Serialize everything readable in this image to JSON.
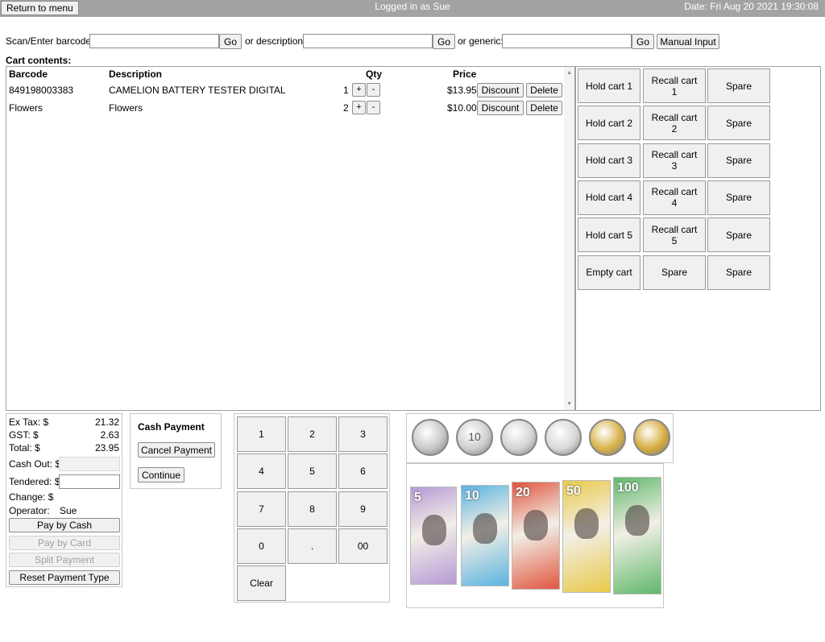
{
  "header": {
    "return_label": "Return to menu",
    "logged_in": "Logged in as Sue",
    "date": "Date: Fri Aug 20 2021 19:30:08"
  },
  "search": {
    "barcode_label": "Scan/Enter barcode:",
    "description_label": "or description:",
    "generic_label": "or generic:",
    "go_label": "Go",
    "manual_input_label": "Manual Input"
  },
  "cart": {
    "title": "Cart contents:",
    "columns": {
      "barcode": "Barcode",
      "description": "Description",
      "qty": "Qty",
      "price": "Price"
    },
    "discount_label": "Discount",
    "delete_label": "Delete",
    "plus_label": "+",
    "minus_label": "-",
    "rows": [
      {
        "barcode": "849198003383",
        "description": "CAMELION BATTERY TESTER DIGITAL",
        "qty": "1",
        "price": "$13.95"
      },
      {
        "barcode": "Flowers",
        "description": "Flowers",
        "qty": "2",
        "price": "$10.00"
      }
    ]
  },
  "hold": {
    "buttons": [
      [
        "Hold cart 1",
        "Recall cart 1",
        "Spare"
      ],
      [
        "Hold cart 2",
        "Recall cart 2",
        "Spare"
      ],
      [
        "Hold cart 3",
        "Recall cart 3",
        "Spare"
      ],
      [
        "Hold cart 4",
        "Recall cart 4",
        "Spare"
      ],
      [
        "Hold cart 5",
        "Recall cart 5",
        "Spare"
      ],
      [
        "Empty cart",
        "Spare",
        "Spare"
      ]
    ]
  },
  "totals": {
    "ex_tax_label": "Ex Tax: $",
    "ex_tax": "21.32",
    "gst_label": "GST: $",
    "gst": "2.63",
    "total_label": "Total: $",
    "total": "23.95",
    "cash_out_label": "Cash Out: $",
    "tendered_label": "Tendered: $",
    "change_label": "Change: $",
    "operator_label": "Operator:",
    "operator": "Sue",
    "pay_cash": "Pay by Cash",
    "pay_card": "Pay by Card",
    "split_payment": "Split Payment",
    "reset_payment": "Reset Payment Type"
  },
  "cash_payment": {
    "title": "Cash Payment",
    "cancel_label": "Cancel Payment",
    "continue_label": "Continue"
  },
  "keypad": {
    "keys": [
      [
        "1",
        "2",
        "3"
      ],
      [
        "4",
        "5",
        "6"
      ],
      [
        "7",
        "8",
        "9"
      ],
      [
        "0",
        ".",
        "00"
      ],
      [
        "Clear"
      ]
    ]
  },
  "coins": [
    {
      "icon": "coin-5c-icon",
      "color": "#c8c8c8"
    },
    {
      "icon": "coin-10c-icon",
      "label": "10",
      "color": "#cfcfcf"
    },
    {
      "icon": "coin-20c-icon",
      "color": "#d4d4d4"
    },
    {
      "icon": "coin-50c-icon",
      "color": "#d8d8d8"
    },
    {
      "icon": "coin-1-dollar-icon",
      "color": "#d9b24a"
    },
    {
      "icon": "coin-2-dollar-icon",
      "color": "#d8ac3e"
    }
  ],
  "notes": [
    {
      "icon": "note-5-icon",
      "label": "5",
      "color": "#b69ad6"
    },
    {
      "icon": "note-10-icon",
      "label": "10",
      "color": "#5bb3e0"
    },
    {
      "icon": "note-20-icon",
      "label": "20",
      "color": "#e0563f"
    },
    {
      "icon": "note-50-icon",
      "label": "50",
      "color": "#e9c94a"
    },
    {
      "icon": "note-100-icon",
      "label": "100",
      "color": "#5fb86b"
    }
  ]
}
